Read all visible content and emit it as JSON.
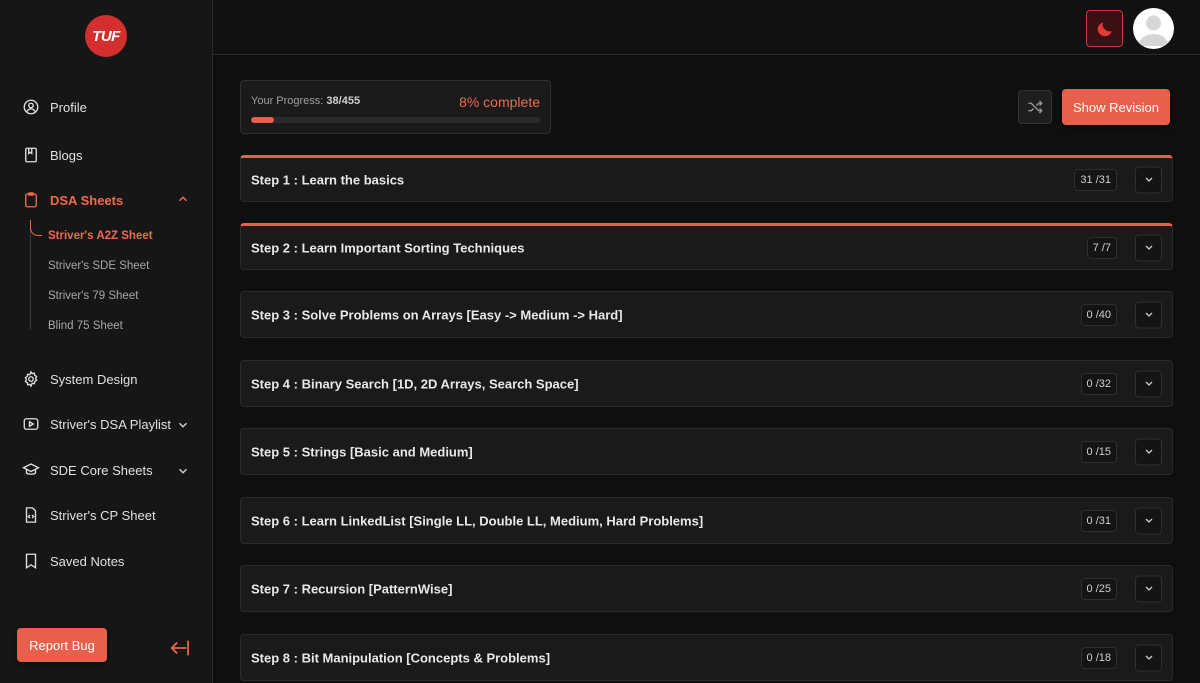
{
  "brand": {
    "logo_text": "TUF",
    "accent": "#e8604c"
  },
  "sidebar": {
    "items": [
      {
        "label": "Profile",
        "icon": "user-circle-icon"
      },
      {
        "label": "Blogs",
        "icon": "book-icon"
      },
      {
        "label": "DSA Sheets",
        "icon": "clipboard-icon",
        "expanded": true
      },
      {
        "label": "System Design",
        "icon": "gear-icon"
      },
      {
        "label": "Striver's DSA Playlist",
        "icon": "youtube-icon"
      },
      {
        "label": "SDE Core Sheets",
        "icon": "graduation-cap-icon"
      },
      {
        "label": "Striver's CP Sheet",
        "icon": "code-file-icon"
      },
      {
        "label": "Saved Notes",
        "icon": "bookmark-icon"
      }
    ],
    "sub_items": [
      {
        "label": "Striver's A2Z Sheet",
        "active": true
      },
      {
        "label": "Striver's SDE Sheet"
      },
      {
        "label": "Striver's 79 Sheet"
      },
      {
        "label": "Blind 75 Sheet"
      }
    ],
    "report_bug_label": "Report Bug"
  },
  "progress": {
    "label": "Your Progress: ",
    "count": "38/455",
    "percent_text": "8% complete",
    "fraction": 0.08
  },
  "actions": {
    "revision_label": "Show Revision"
  },
  "steps": [
    {
      "title": "Step 1 : Learn the basics",
      "count": "31 /31",
      "done": true
    },
    {
      "title": "Step 2 : Learn Important Sorting Techniques",
      "count": "7 /7",
      "done": true
    },
    {
      "title": "Step 3 : Solve Problems on Arrays [Easy -> Medium -> Hard]",
      "count": "0 /40",
      "done": false
    },
    {
      "title": "Step 4 : Binary Search [1D, 2D Arrays, Search Space]",
      "count": "0 /32",
      "done": false
    },
    {
      "title": "Step 5 : Strings [Basic and Medium]",
      "count": "0 /15",
      "done": false
    },
    {
      "title": "Step 6 : Learn LinkedList [Single LL, Double LL, Medium, Hard Problems]",
      "count": "0 /31",
      "done": false
    },
    {
      "title": "Step 7 : Recursion [PatternWise]",
      "count": "0 /25",
      "done": false
    },
    {
      "title": "Step 8 : Bit Manipulation [Concepts & Problems]",
      "count": "0 /18",
      "done": false
    }
  ]
}
